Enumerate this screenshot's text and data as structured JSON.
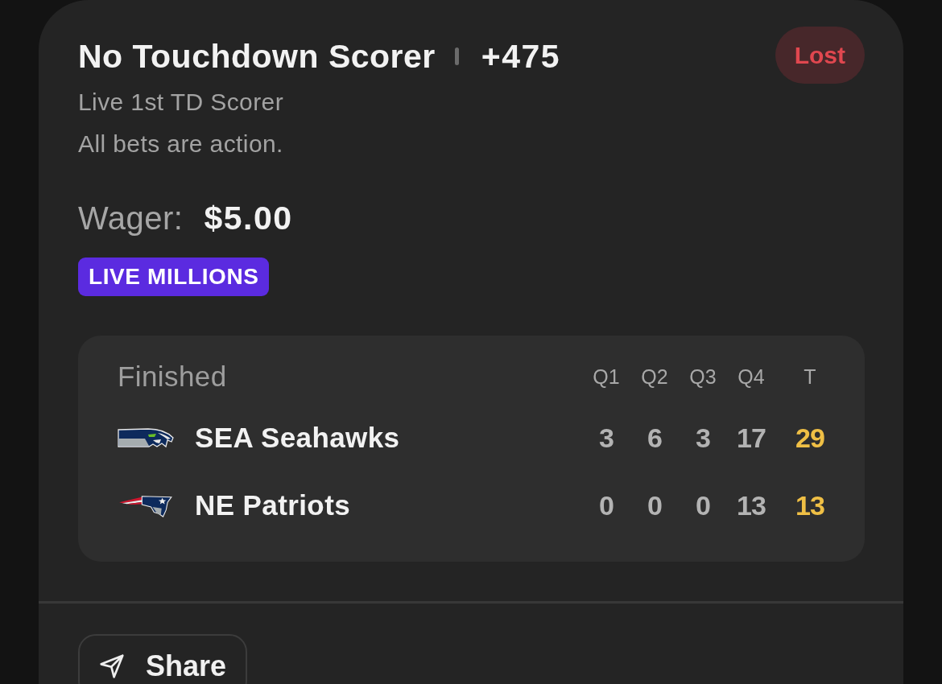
{
  "bet": {
    "selection": "No Touchdown Scorer",
    "odds": "+475",
    "status": {
      "label": "Lost",
      "kind": "lost"
    },
    "market": "Live 1st TD Scorer",
    "note": "All bets are action."
  },
  "wager": {
    "label": "Wager:",
    "amount": "$5.00"
  },
  "promo_tag": "LIVE MILLIONS",
  "scoreboard": {
    "status": "Finished",
    "columns": [
      "Q1",
      "Q2",
      "Q3",
      "Q4",
      "T"
    ],
    "teams": [
      {
        "kind": "bird",
        "name": "SEA Seahawks",
        "scores": [
          "3",
          "6",
          "3",
          "17"
        ],
        "total": "29"
      },
      {
        "kind": "head",
        "name": "NE Patriots",
        "scores": [
          "0",
          "0",
          "0",
          "13"
        ],
        "total": "13"
      }
    ]
  },
  "share_button": {
    "label": "Share"
  }
}
